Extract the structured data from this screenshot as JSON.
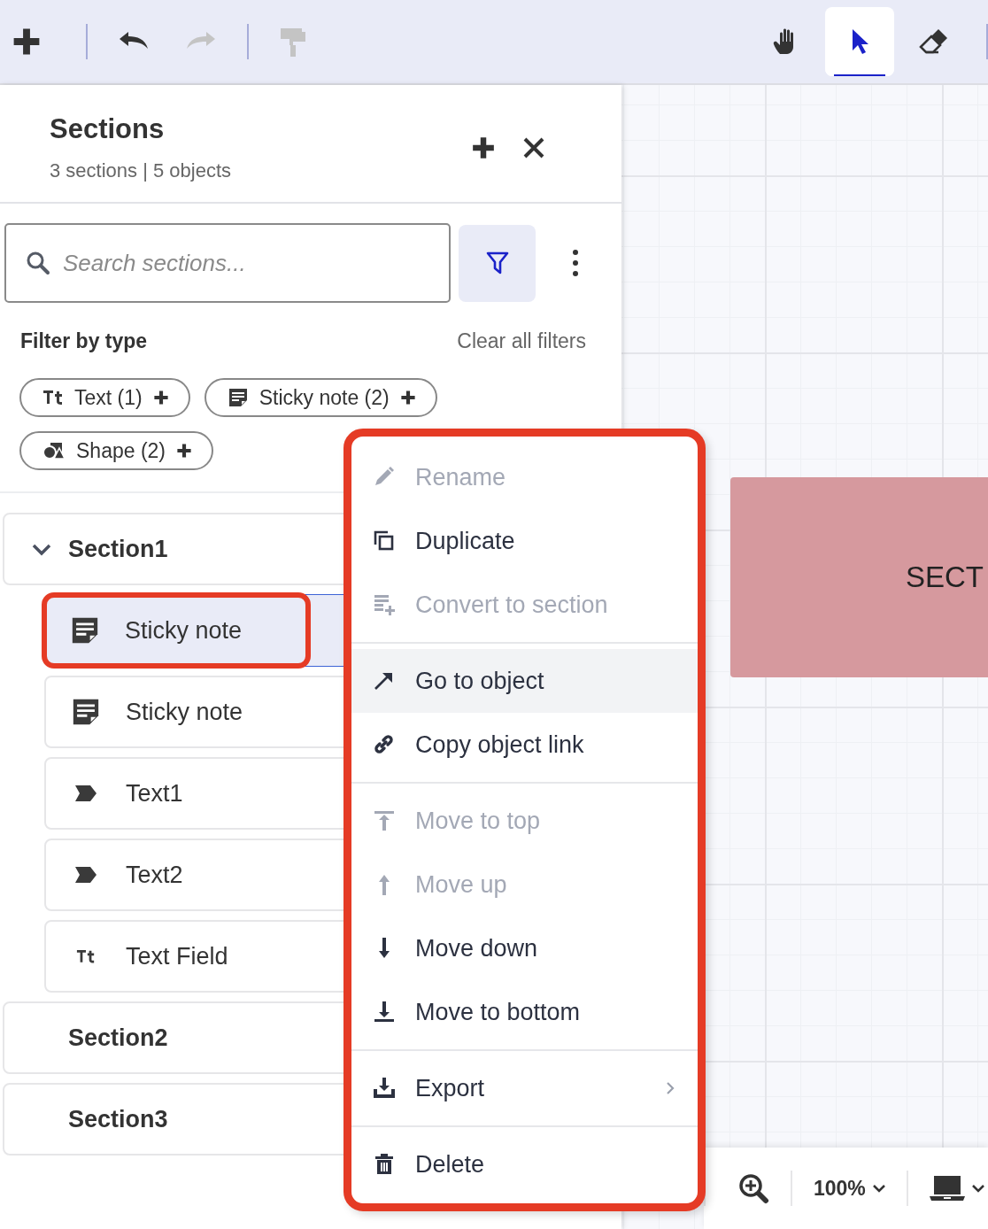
{
  "toolbar": {
    "left": [
      {
        "kind": "button",
        "disabled": false
      },
      {
        "kind": "separator"
      },
      {
        "kind": "button",
        "disabled": false
      },
      {
        "kind": "button",
        "disabled": true
      },
      {
        "kind": "separator"
      },
      {
        "kind": "button",
        "disabled": true
      }
    ],
    "right": [
      {
        "selected": false
      },
      {
        "selected": true
      },
      {
        "selected": false
      }
    ]
  },
  "panel": {
    "title": "Sections",
    "subtitle": "3 sections | 5 objects"
  },
  "search": {
    "placeholder": "Search sections...",
    "filter_active": true
  },
  "filter": {
    "heading": "Filter by type",
    "clear": "Clear all filters",
    "chips": [
      {
        "kind": "text",
        "label": "Text (1)"
      },
      {
        "kind": "sticky",
        "label": "Sticky note (2)"
      },
      {
        "kind": "shape",
        "label": "Shape (2)"
      }
    ]
  },
  "sections": [
    {
      "name": "Section1",
      "expanded": true,
      "children": [
        {
          "kind": "sticky",
          "name": "Sticky note",
          "selected": true,
          "highlighted": true
        },
        {
          "kind": "sticky",
          "name": "Sticky note",
          "selected": false,
          "highlighted": false
        },
        {
          "kind": "shape",
          "name": "Text1",
          "selected": false,
          "highlighted": false
        },
        {
          "kind": "shape",
          "name": "Text2",
          "selected": false,
          "highlighted": false
        },
        {
          "kind": "text",
          "name": "Text Field",
          "selected": false,
          "highlighted": false
        }
      ]
    },
    {
      "name": "Section2",
      "expanded": false
    },
    {
      "name": "Section3",
      "expanded": false
    }
  ],
  "context_menu": {
    "highlighted": true,
    "items": [
      {
        "kind": "item",
        "label": "Rename",
        "disabled": true,
        "hovered": false
      },
      {
        "kind": "item",
        "label": "Duplicate",
        "disabled": false,
        "hovered": false
      },
      {
        "kind": "item",
        "label": "Convert to section",
        "disabled": true,
        "hovered": false
      },
      {
        "kind": "divider"
      },
      {
        "kind": "item",
        "label": "Go to object",
        "disabled": false,
        "hovered": true
      },
      {
        "kind": "item",
        "label": "Copy object link",
        "disabled": false,
        "hovered": false
      },
      {
        "kind": "divider"
      },
      {
        "kind": "item",
        "label": "Move to top",
        "disabled": true,
        "hovered": false
      },
      {
        "kind": "item",
        "label": "Move up",
        "disabled": true,
        "hovered": false
      },
      {
        "kind": "item",
        "label": "Move down",
        "disabled": false,
        "hovered": false
      },
      {
        "kind": "item",
        "label": "Move to bottom",
        "disabled": false,
        "hovered": false
      },
      {
        "kind": "divider"
      },
      {
        "kind": "item",
        "label": "Export",
        "disabled": false,
        "hovered": false,
        "submenu": true
      },
      {
        "kind": "divider"
      },
      {
        "kind": "item",
        "label": "Delete",
        "disabled": false,
        "hovered": false
      }
    ]
  },
  "canvas": {
    "shapes": [
      {
        "label": "SECT"
      }
    ]
  },
  "zoom": {
    "value": "100%"
  }
}
